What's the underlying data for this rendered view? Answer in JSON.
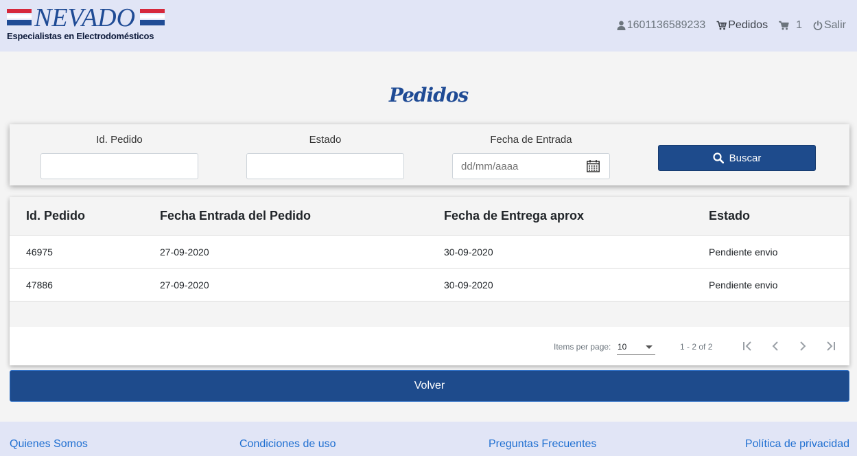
{
  "header": {
    "brand_word": "NEVADO",
    "brand_tagline": "Especialistas en Electrodomésticos",
    "user_id": "1601136589233",
    "orders_label": "Pedidos",
    "cart_count": "1",
    "logout_label": "Salir"
  },
  "page": {
    "title": "Pedidos"
  },
  "filters": {
    "order_id_label": "Id. Pedido",
    "order_id_value": "",
    "status_label": "Estado",
    "status_value": "",
    "date_label": "Fecha de Entrada",
    "date_placeholder": "dd/mm/aaaa",
    "search_label": "Buscar"
  },
  "table": {
    "columns": [
      "Id. Pedido",
      "Fecha Entrada del Pedido",
      "Fecha de Entrega aprox",
      "Estado"
    ],
    "rows": [
      [
        "46975",
        "27-09-2020",
        "30-09-2020",
        "Pendiente envio"
      ],
      [
        "47886",
        "27-09-2020",
        "30-09-2020",
        "Pendiente envio"
      ]
    ]
  },
  "paginator": {
    "items_per_page_label": "Items per page:",
    "items_per_page_value": "10",
    "range_label": "1 - 2 of 2"
  },
  "back_label": "Volver",
  "footer": {
    "links": [
      "Quienes Somos",
      "Condiciones de uso",
      "Preguntas Frecuentes",
      "Política de privacidad"
    ]
  },
  "colors": {
    "header_bg": "#e1e5f6",
    "primary": "#1e4b8c",
    "brand_red": "#d6283b",
    "link": "#1f6fd1"
  }
}
